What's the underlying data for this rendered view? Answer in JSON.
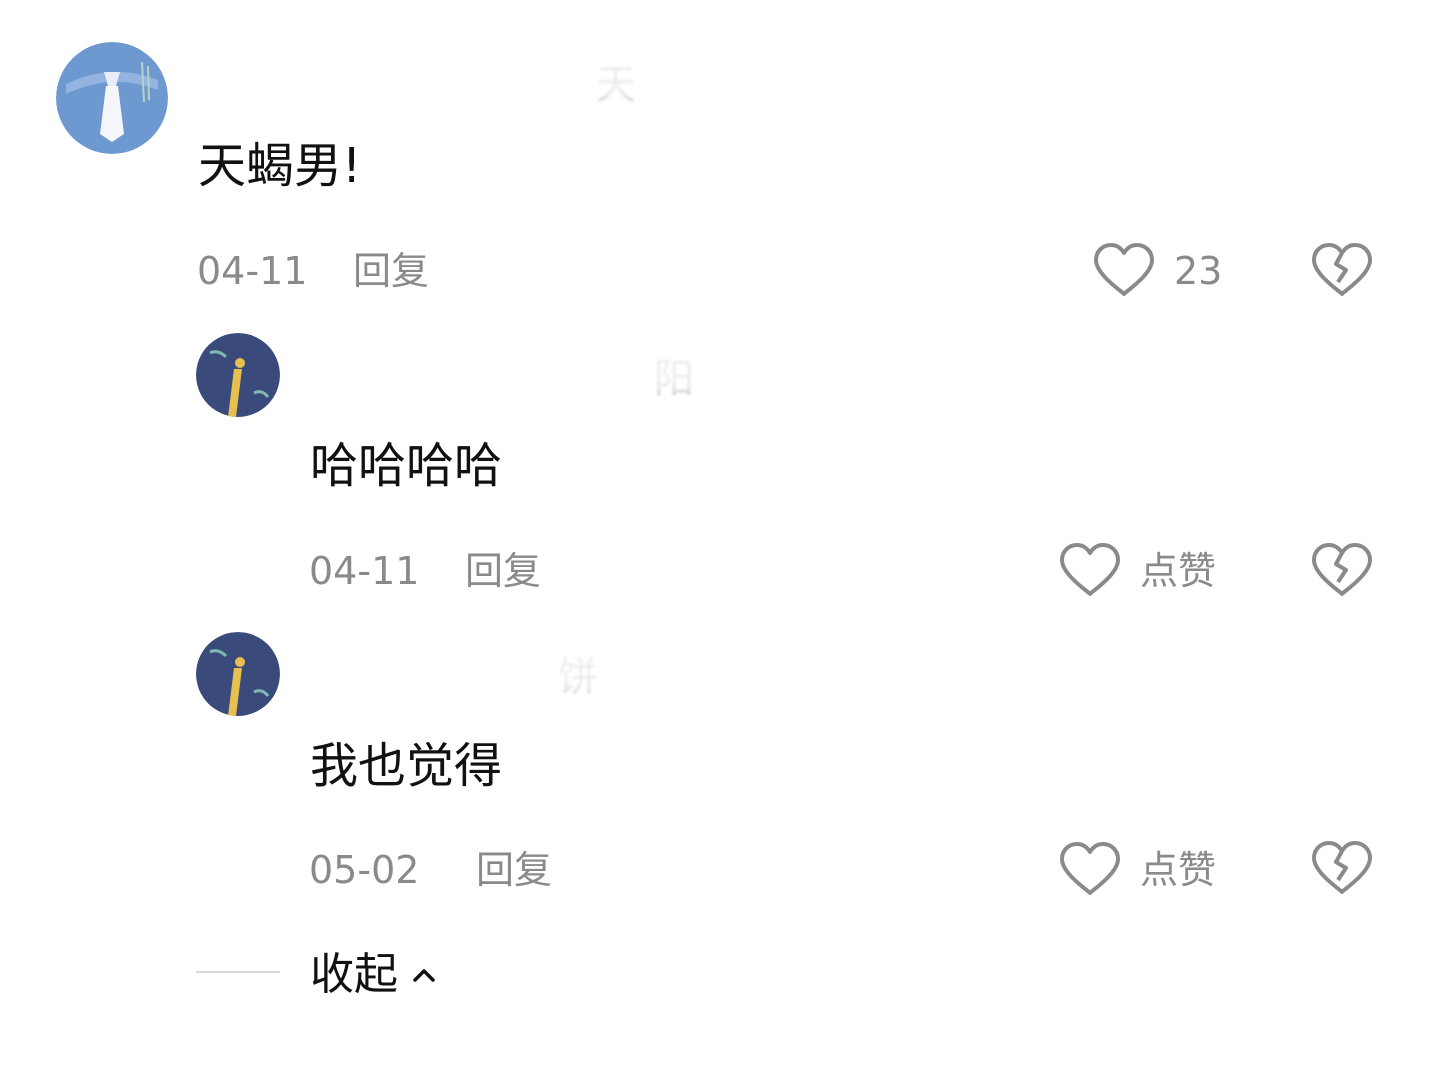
{
  "comments": [
    {
      "author_name": "天",
      "text": "天蝎男!",
      "date": "04-11",
      "reply_label": "回复",
      "like_label": "23",
      "icons": {
        "like": "heart-icon",
        "dislike": "broken-heart-icon"
      }
    },
    {
      "author_name": "阳",
      "text": "哈哈哈哈",
      "date": "04-11",
      "reply_label": "回复",
      "like_label": "点赞",
      "icons": {
        "like": "heart-icon",
        "dislike": "broken-heart-icon"
      }
    },
    {
      "author_name": "饼",
      "text": "我也觉得",
      "date": "05-02",
      "reply_label": "回复",
      "like_label": "点赞",
      "icons": {
        "like": "heart-icon",
        "dislike": "broken-heart-icon"
      }
    }
  ],
  "collapse": {
    "label": "收起",
    "icon": "chevron-up-icon"
  },
  "colors": {
    "meta_gray": "#8a8a8a",
    "text": "#111111",
    "avatar_blue": "#6d98d0",
    "avatar_navy": "#3a4a7a"
  }
}
